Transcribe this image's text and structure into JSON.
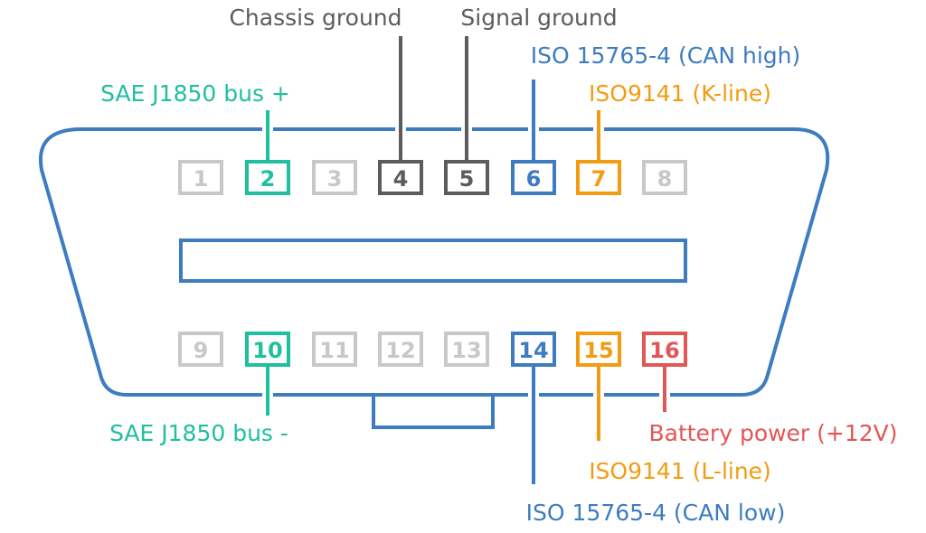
{
  "colors": {
    "teal": "#1fbf9f",
    "dark": "#5c5c5c",
    "light": "#c8c8c8",
    "blue": "#3d7cc0",
    "orange": "#f39c12",
    "red": "#e35656",
    "outline": "#3d7cc0"
  },
  "pins": [
    {
      "n": "1",
      "color": "light"
    },
    {
      "n": "2",
      "color": "teal"
    },
    {
      "n": "3",
      "color": "light"
    },
    {
      "n": "4",
      "color": "dark"
    },
    {
      "n": "5",
      "color": "dark"
    },
    {
      "n": "6",
      "color": "blue"
    },
    {
      "n": "7",
      "color": "orange"
    },
    {
      "n": "8",
      "color": "light"
    },
    {
      "n": "9",
      "color": "light"
    },
    {
      "n": "10",
      "color": "teal"
    },
    {
      "n": "11",
      "color": "light"
    },
    {
      "n": "12",
      "color": "light"
    },
    {
      "n": "13",
      "color": "light"
    },
    {
      "n": "14",
      "color": "blue"
    },
    {
      "n": "15",
      "color": "orange"
    },
    {
      "n": "16",
      "color": "red"
    }
  ],
  "labels": [
    {
      "pin": "2",
      "text": "SAE J1850 bus +",
      "color": "teal"
    },
    {
      "pin": "4",
      "text": "Chassis ground",
      "color": "dark"
    },
    {
      "pin": "5",
      "text": "Signal ground",
      "color": "dark"
    },
    {
      "pin": "6",
      "text": "ISO 15765-4 (CAN high)",
      "color": "blue"
    },
    {
      "pin": "7",
      "text": "ISO9141 (K-line)",
      "color": "orange"
    },
    {
      "pin": "10",
      "text": "SAE J1850 bus -",
      "color": "teal"
    },
    {
      "pin": "14",
      "text": "ISO 15765-4 (CAN low)",
      "color": "blue"
    },
    {
      "pin": "15",
      "text": "ISO9141 (L-line)",
      "color": "orange"
    },
    {
      "pin": "16",
      "text": "Battery power (+12V)",
      "color": "red"
    }
  ]
}
